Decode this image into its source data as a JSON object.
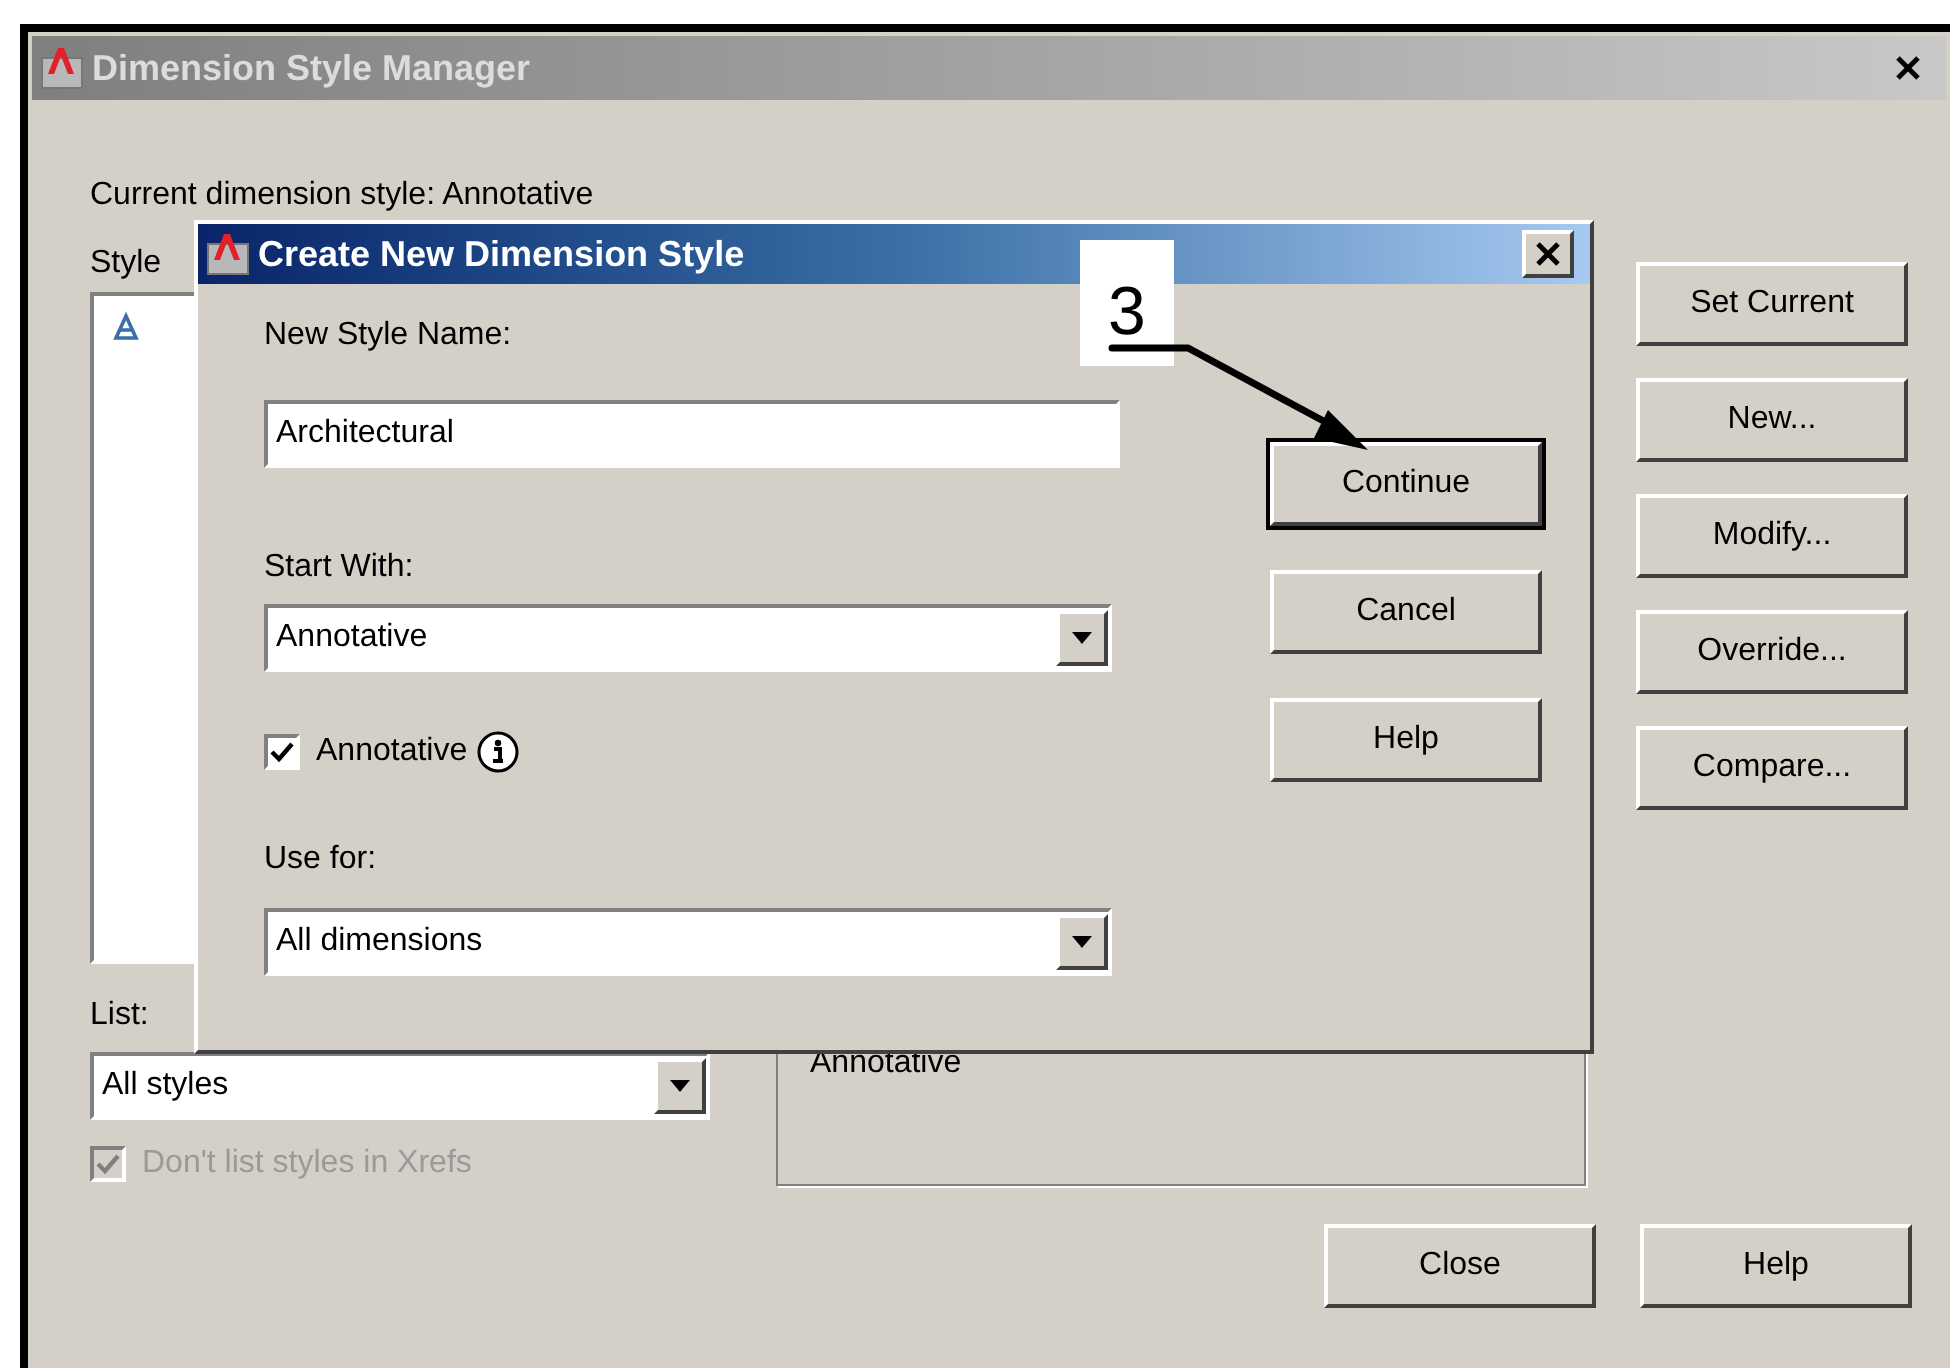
{
  "window": {
    "title": "Dimension Style Manager",
    "current_style_label": "Current dimension style: Annotative",
    "styles_label": "Style",
    "list_label": "List:",
    "list_filter": {
      "value": "All styles"
    },
    "xrefs_checkbox": {
      "label": "Don't list styles in Xrefs",
      "checked": true,
      "disabled": true
    },
    "preview_text": "Annotative",
    "side_buttons": [
      "Set Current",
      "New...",
      "Modify...",
      "Override...",
      "Compare..."
    ],
    "bottom_buttons": [
      "Close",
      "Help"
    ]
  },
  "dialog": {
    "title": "Create New Dimension Style",
    "name_label": "New Style Name:",
    "name_value": "Architectural",
    "start_label": "Start With:",
    "start_value": "Annotative",
    "annotative": {
      "label": "Annotative",
      "checked": true
    },
    "use_label": "Use for:",
    "use_value": "All dimensions",
    "buttons": [
      {
        "label": "Continue",
        "default": true
      },
      {
        "label": "Cancel",
        "default": false
      },
      {
        "label": "Help",
        "default": false
      }
    ]
  },
  "callout": {
    "label": "3"
  }
}
